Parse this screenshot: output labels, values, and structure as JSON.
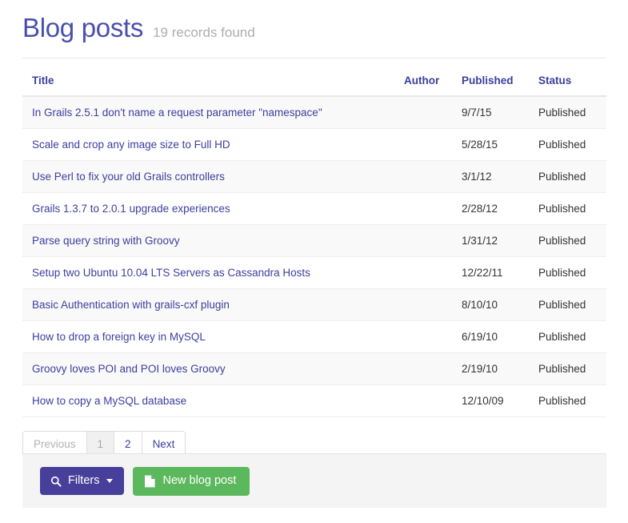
{
  "header": {
    "title": "Blog posts",
    "subtitle": "19 records found"
  },
  "table": {
    "columns": [
      {
        "key": "title",
        "label": "Title"
      },
      {
        "key": "author",
        "label": "Author"
      },
      {
        "key": "published",
        "label": "Published"
      },
      {
        "key": "status",
        "label": "Status"
      }
    ],
    "rows": [
      {
        "title": "In Grails 2.5.1 don't name a request parameter \"namespace\"",
        "author": "",
        "published": "9/7/15",
        "status": "Published"
      },
      {
        "title": "Scale and crop any image size to Full HD",
        "author": "",
        "published": "5/28/15",
        "status": "Published"
      },
      {
        "title": "Use Perl to fix your old Grails controllers",
        "author": "",
        "published": "3/1/12",
        "status": "Published"
      },
      {
        "title": "Grails 1.3.7 to 2.0.1 upgrade experiences",
        "author": "",
        "published": "2/28/12",
        "status": "Published"
      },
      {
        "title": "Parse query string with Groovy",
        "author": "",
        "published": "1/31/12",
        "status": "Published"
      },
      {
        "title": "Setup two Ubuntu 10.04 LTS Servers as Cassandra Hosts",
        "author": "",
        "published": "12/22/11",
        "status": "Published"
      },
      {
        "title": "Basic Authentication with grails-cxf plugin",
        "author": "",
        "published": "8/10/10",
        "status": "Published"
      },
      {
        "title": "How to drop a foreign key in MySQL",
        "author": "",
        "published": "6/19/10",
        "status": "Published"
      },
      {
        "title": "Groovy loves POI and POI loves Groovy",
        "author": "",
        "published": "2/19/10",
        "status": "Published"
      },
      {
        "title": "How to copy a MySQL database",
        "author": "",
        "published": "12/10/09",
        "status": "Published"
      }
    ]
  },
  "pagination": {
    "previous_label": "Previous",
    "pages": [
      "1",
      "2"
    ],
    "active_page": "1",
    "next_label": "Next"
  },
  "footer": {
    "filters_label": "Filters",
    "filters_icon": "search-icon",
    "new_post_label": "New blog post",
    "new_post_icon": "file-icon"
  },
  "colors": {
    "title": "#4a4fae",
    "link": "#3b3f9e",
    "filters_button": "#46409b",
    "new_button": "#5cb85c",
    "row_stripe": "#f9f9f9",
    "footer_bar": "#f4f4f4",
    "subtitle": "#adadad"
  }
}
